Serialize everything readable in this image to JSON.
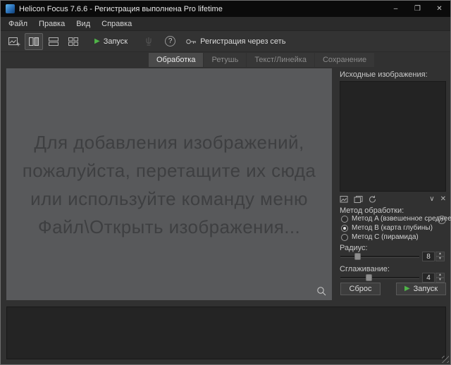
{
  "window": {
    "title": "Helicon Focus 7.6.6 - Регистрация выполнена Pro lifetime",
    "minimize_glyph": "–",
    "maximize_glyph": "❒",
    "close_glyph": "✕"
  },
  "menu": {
    "items": [
      "Файл",
      "Правка",
      "Вид",
      "Справка"
    ]
  },
  "toolbar": {
    "run_label": "Запуск",
    "run_glyph": "▶",
    "help_glyph": "?",
    "register_label": "Регистрация через сеть"
  },
  "tabs": {
    "processing": "Обработка",
    "retouch": "Ретушь",
    "text_ruler": "Текст/Линейка",
    "saving": "Сохранение"
  },
  "dropzone": {
    "line1": "Для добавления изображений,",
    "line2": "пожалуйста, перетащите их сюда",
    "line3": "или используйте команду меню",
    "line4": "Файл\\Открыть изображения..."
  },
  "sidebar": {
    "sources_label": "Исходные изображения:",
    "chevron_glyph": "∨",
    "close_glyph": "✕",
    "method_label": "Метод обработки:",
    "method_a": "Метод A (взвешенное среднее)",
    "method_b": "Метод B (карта глубины)",
    "method_c": "Метод C (пирамида)",
    "selected_method": "B",
    "help_glyph": "?",
    "radius_label": "Радиус:",
    "radius_value": "8",
    "smoothing_label": "Сглаживание:",
    "smoothing_value": "4",
    "spin_up_glyph": "▲",
    "spin_down_glyph": "▼",
    "reset_label": "Сброс",
    "run_label": "Запуск",
    "run_glyph": "▶"
  },
  "colors": {
    "accent_green": "#4fb448",
    "dropzone_bg": "#58595b",
    "titlebar_bg": "#0b0b0b"
  }
}
